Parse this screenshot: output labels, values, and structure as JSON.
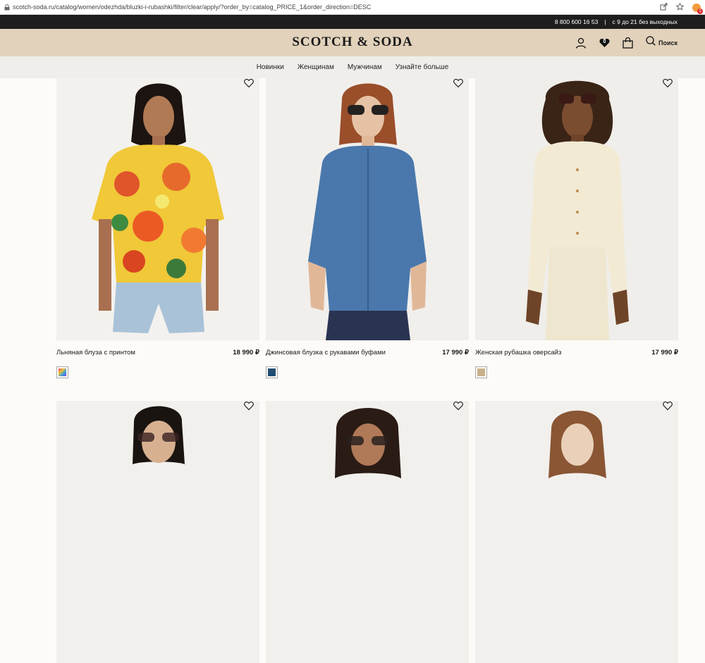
{
  "browser": {
    "url": "scotch-soda.ru/catalog/women/odezhda/bluzki-i-rubashki/filter/clear/apply/?order_by=catalog_PRICE_1&order_direction=DESC"
  },
  "infobar": {
    "phone": "8 800 600 16 53",
    "separator": "|",
    "hours": "с 9 до 21 без выходных"
  },
  "header": {
    "logo": "SCOTCH & SODA",
    "wishlist_count": "0",
    "search_label": "Поиск"
  },
  "nav": {
    "items": [
      "Новинки",
      "Женщинам",
      "Мужчинам",
      "Узнайте больше"
    ]
  },
  "products": [
    {
      "name": "Льняная блуза с принтом",
      "price": "18 990 ₽",
      "swatch_color": "#d03a8a"
    },
    {
      "name": "Джинсовая блузка с рукавами буфами",
      "price": "17 990 ₽",
      "swatch_color": "#1f4e72"
    },
    {
      "name": "Женская рубашка оверсайз",
      "price": "17 990 ₽",
      "swatch_color": "#c8b08a"
    }
  ],
  "colors": {
    "header_bg": "#e2d2bb",
    "infobar_bg": "#1e1e1e",
    "nav_bg": "#f0eeea"
  }
}
